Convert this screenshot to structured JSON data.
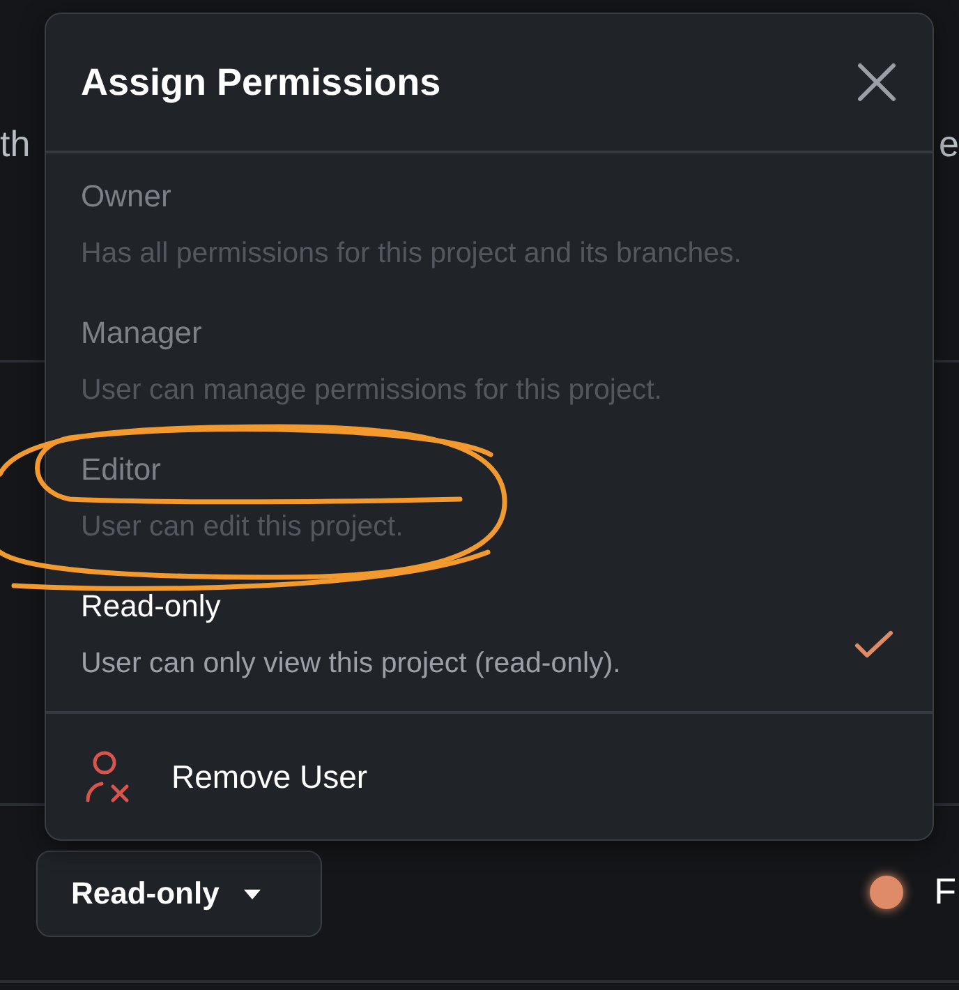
{
  "page": {
    "top_text_left": "th",
    "top_text_right": "e",
    "role_dropdown": {
      "label": "Read-only"
    },
    "status_dot": {
      "color": "#e08b68"
    },
    "status_label": "F"
  },
  "dialog": {
    "title": "Assign Permissions",
    "options": [
      {
        "name": "Owner",
        "description": "Has all permissions for this project and its branches.",
        "disabled": true,
        "selected": false
      },
      {
        "name": "Manager",
        "description": "User can manage permissions for this project.",
        "disabled": true,
        "selected": false
      },
      {
        "name": "Editor",
        "description": "User can edit this project.",
        "disabled": true,
        "selected": false
      },
      {
        "name": "Read-only",
        "description": "User can only view this project (read-only).",
        "disabled": false,
        "selected": true
      }
    ],
    "remove_action": {
      "label": "Remove User"
    }
  }
}
